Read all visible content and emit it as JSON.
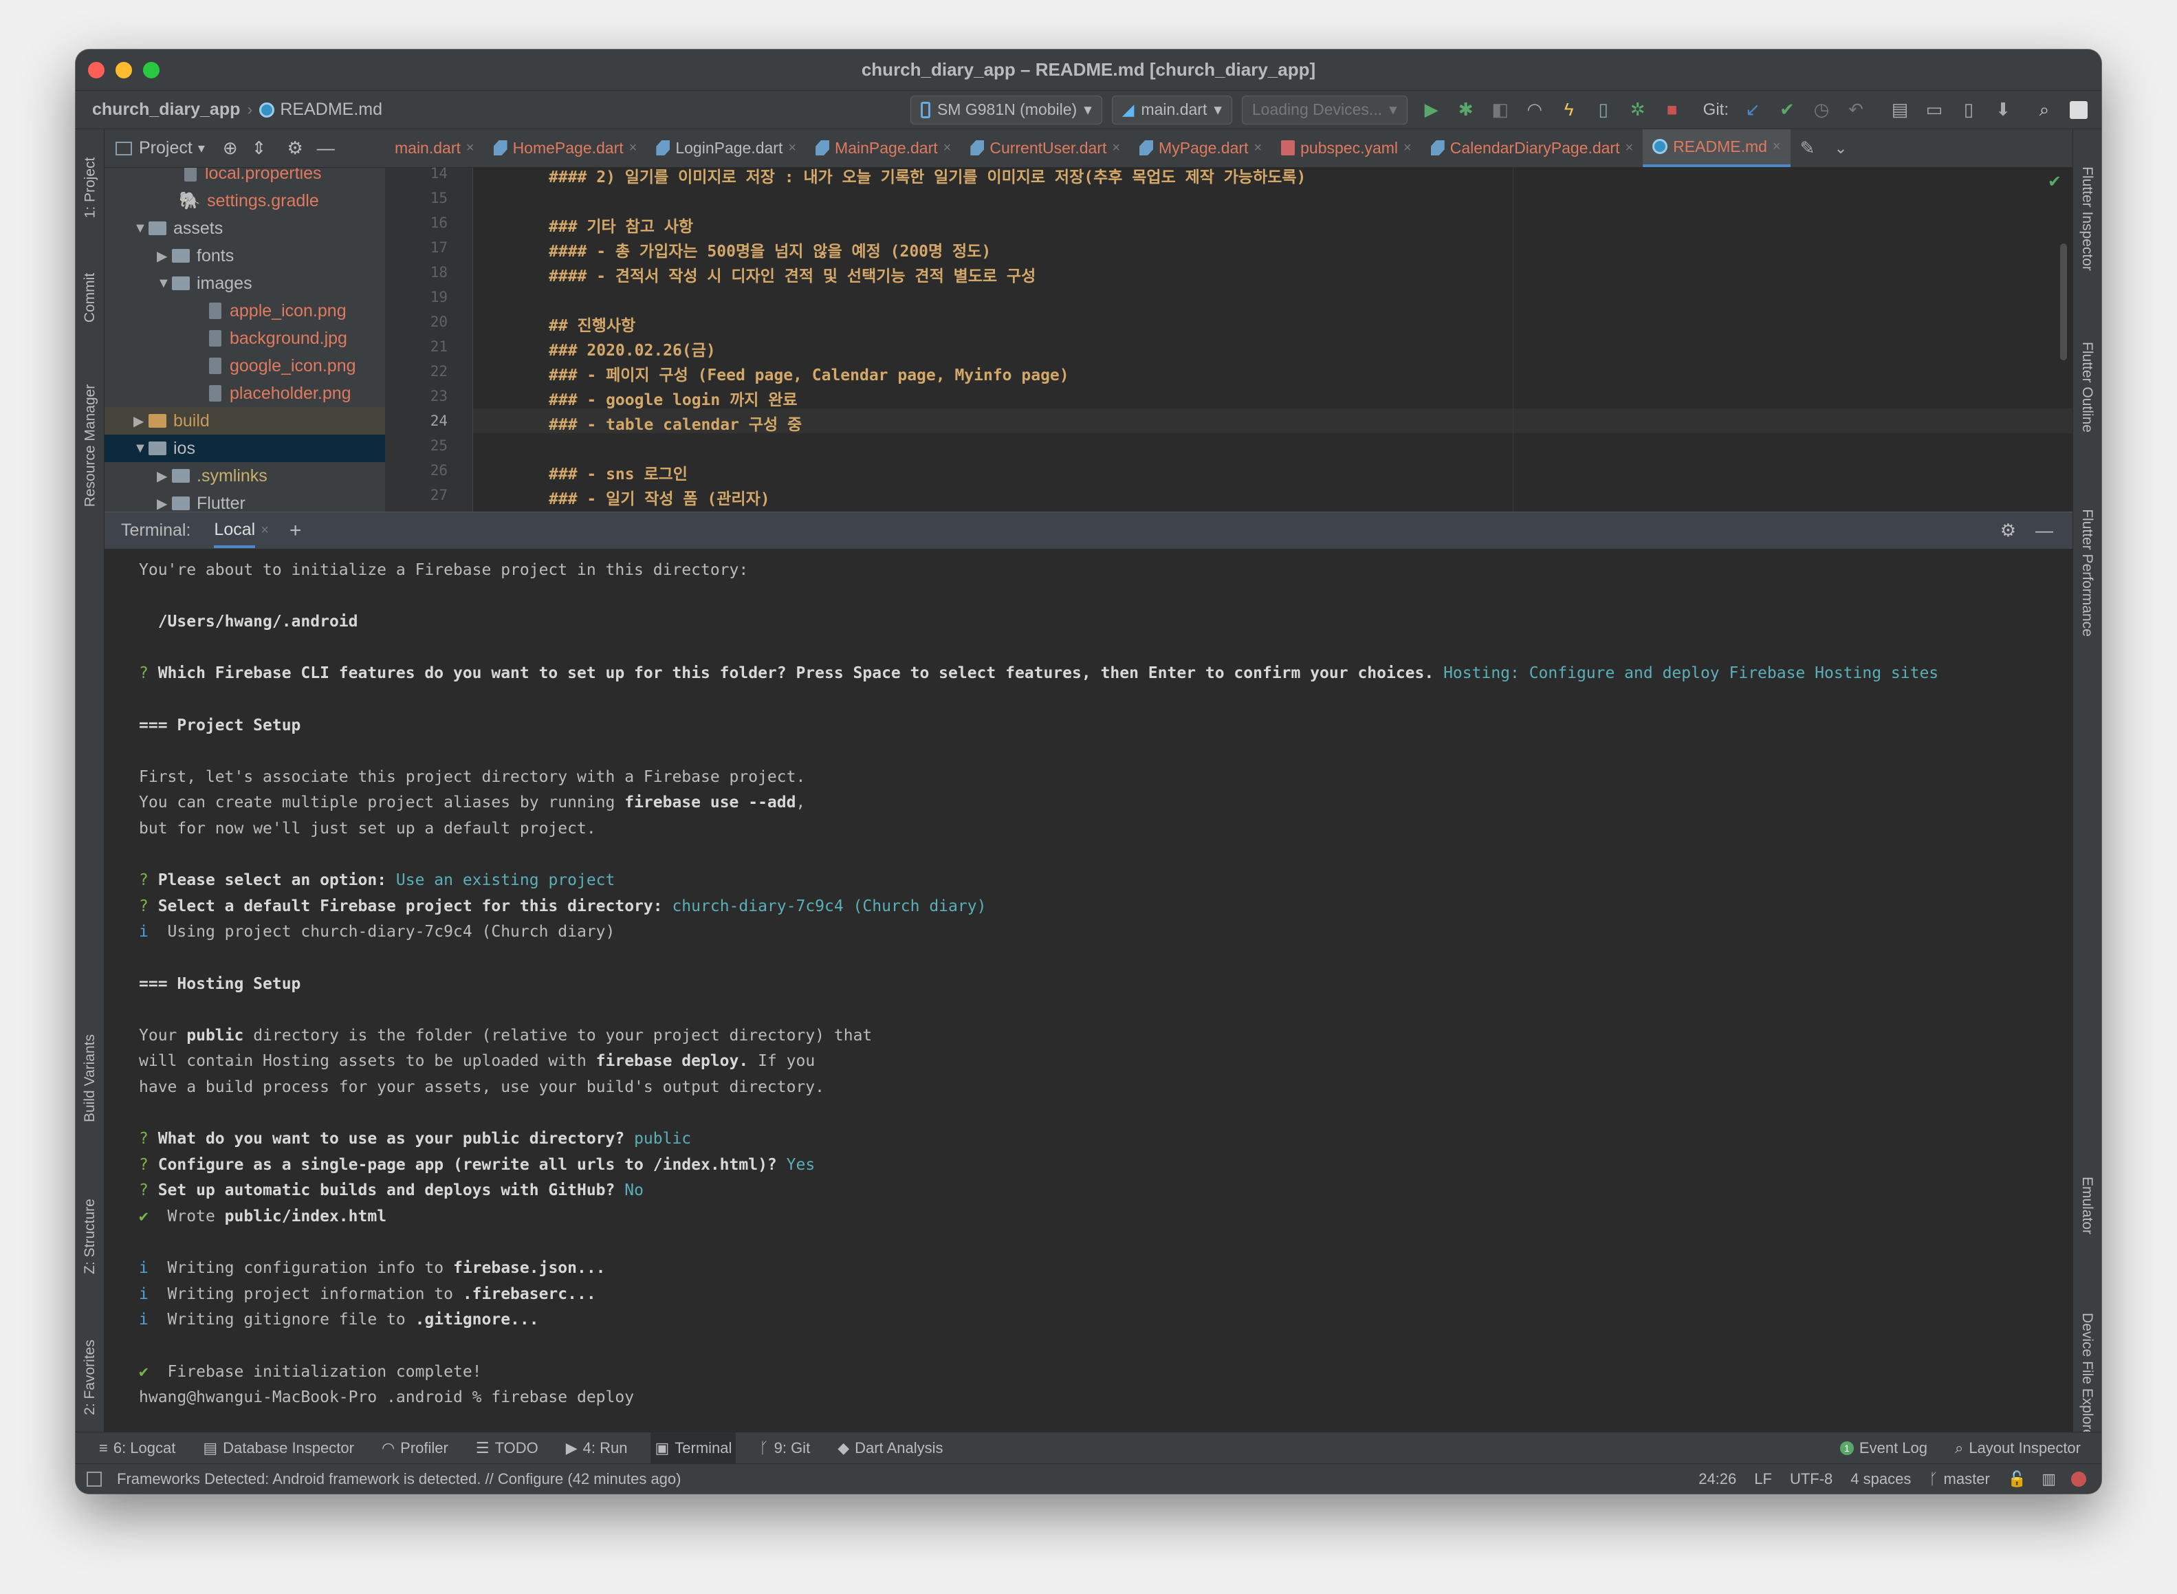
{
  "window": {
    "title": "church_diary_app – README.md [church_diary_app]"
  },
  "nav": {
    "project": "church_diary_app",
    "file": "README.md",
    "device": "SM G981N (mobile)",
    "run_config": "main.dart",
    "devices_loading": "Loading Devices...",
    "git_label": "Git:"
  },
  "project_panel": {
    "label": "Project"
  },
  "tabs": [
    {
      "label": "main.dart",
      "icon": "none"
    },
    {
      "label": "HomePage.dart",
      "icon": "dart-file-icon"
    },
    {
      "label": "LoginPage.dart",
      "icon": "dart-file-icon"
    },
    {
      "label": "MainPage.dart",
      "icon": "dart-file-icon"
    },
    {
      "label": "CurrentUser.dart",
      "icon": "dart-file-icon"
    },
    {
      "label": "MyPage.dart",
      "icon": "dart-file-icon"
    },
    {
      "label": "pubspec.yaml",
      "icon": "yaml-file-icon"
    },
    {
      "label": "CalendarDiaryPage.dart",
      "icon": "dart-file-icon"
    },
    {
      "label": "README.md",
      "icon": "markdown-file-icon",
      "active": true
    }
  ],
  "tree": [
    {
      "label": "local.properties",
      "kind": "file",
      "color": "#e07a5f"
    },
    {
      "label": "settings.gradle",
      "kind": "file",
      "color": "#e07a5f"
    },
    {
      "label": "assets",
      "kind": "folder",
      "expanded": true,
      "color": "#bbbbbb"
    },
    {
      "label": "fonts",
      "kind": "folder",
      "expanded": false,
      "color": "#bbbbbb"
    },
    {
      "label": "images",
      "kind": "folder",
      "expanded": true,
      "color": "#bbbbbb"
    },
    {
      "label": "apple_icon.png",
      "kind": "file",
      "color": "#e07a5f"
    },
    {
      "label": "background.jpg",
      "kind": "file",
      "color": "#e07a5f"
    },
    {
      "label": "google_icon.png",
      "kind": "file",
      "color": "#e07a5f"
    },
    {
      "label": "placeholder.png",
      "kind": "file",
      "color": "#e07a5f"
    },
    {
      "label": "build",
      "kind": "folder",
      "expanded": false,
      "color": "#c89a5a"
    },
    {
      "label": "ios",
      "kind": "folder",
      "expanded": true,
      "color": "#bbbbbb"
    },
    {
      "label": ".symlinks",
      "kind": "folder",
      "expanded": false,
      "color": "#c9b06a"
    },
    {
      "label": "Flutter",
      "kind": "folder",
      "expanded": false,
      "color": "#bbbbbb"
    }
  ],
  "editor": {
    "line_numbers": [
      "14",
      "15",
      "16",
      "17",
      "18",
      "19",
      "20",
      "21",
      "22",
      "23",
      "24",
      "25",
      "26",
      "27"
    ],
    "current_line": "24",
    "lines": [
      "#### 2) 일기를 이미지로 저장 : 내가 오늘 기록한 일기를 이미지로 저장(추후 목업도 제작 가능하도록)",
      "",
      "### 기타 참고 사항",
      "#### - 총 가입자는 500명을 넘지 않을 예정 (200명 정도)",
      "#### - 견적서 작성 시 디자인 견적 및 선택기능 견적 별도로 구성",
      "",
      "## 진행사항",
      "### 2020.02.26(금)",
      "### - 페이지 구성 (Feed page, Calendar page, Myinfo page)",
      "### - google login 까지 완료",
      "### - table calendar 구성 중",
      "",
      "### - sns 로그인",
      "### - 일기 작성 폼 (관리자)"
    ]
  },
  "terminal": {
    "label": "Terminal:",
    "tab": "Local",
    "lines": [
      [
        {
          "t": "You're about to initialize a Firebase project in this directory:"
        }
      ],
      [],
      [
        {
          "t": "  /Users/hwang/.android",
          "s": "b"
        }
      ],
      [],
      [
        {
          "t": "? ",
          "s": "g"
        },
        {
          "t": "Which Firebase CLI features do you want to set up for this folder? Press Space to select features, then Enter to confirm your choices.",
          "s": "b"
        },
        {
          "t": " Hosting: Configure and deploy Firebase Hosting sites",
          "s": "c"
        }
      ],
      [],
      [
        {
          "t": "=== ",
          "s": "b"
        },
        {
          "t": "Project Setup",
          "s": "b"
        }
      ],
      [],
      [
        {
          "t": "First, let's associate this project directory with a Firebase project."
        }
      ],
      [
        {
          "t": "You can create multiple project aliases by running "
        },
        {
          "t": "firebase use --add",
          "s": "b"
        },
        {
          "t": ","
        }
      ],
      [
        {
          "t": "but for now we'll just set up a default project."
        }
      ],
      [],
      [
        {
          "t": "? ",
          "s": "g"
        },
        {
          "t": "Please select an option:",
          "s": "b"
        },
        {
          "t": " Use an existing project",
          "s": "c"
        }
      ],
      [
        {
          "t": "? ",
          "s": "g"
        },
        {
          "t": "Select a default Firebase project for this directory:",
          "s": "b"
        },
        {
          "t": " church-diary-7c9c4 (Church diary)",
          "s": "c"
        }
      ],
      [
        {
          "t": "i ",
          "s": "bi"
        },
        {
          "t": " Using project church-diary-7c9c4 (Church diary)"
        }
      ],
      [],
      [
        {
          "t": "=== ",
          "s": "b"
        },
        {
          "t": "Hosting Setup",
          "s": "b"
        }
      ],
      [],
      [
        {
          "t": "Your "
        },
        {
          "t": "public",
          "s": "b"
        },
        {
          "t": " directory is the folder (relative to your project directory) that"
        }
      ],
      [
        {
          "t": "will contain Hosting assets to be uploaded with "
        },
        {
          "t": "firebase deploy.",
          "s": "b"
        },
        {
          "t": " If you"
        }
      ],
      [
        {
          "t": "have a build process for your assets, use your build's output directory."
        }
      ],
      [],
      [
        {
          "t": "? ",
          "s": "g"
        },
        {
          "t": "What do you want to use as your public directory?",
          "s": "b"
        },
        {
          "t": " public",
          "s": "c"
        }
      ],
      [
        {
          "t": "? ",
          "s": "g"
        },
        {
          "t": "Configure as a single-page app (rewrite all urls to /index.html)?",
          "s": "b"
        },
        {
          "t": " Yes",
          "s": "c"
        }
      ],
      [
        {
          "t": "? ",
          "s": "g"
        },
        {
          "t": "Set up automatic builds and deploys with GitHub?",
          "s": "b"
        },
        {
          "t": " No",
          "s": "c"
        }
      ],
      [
        {
          "t": "✔ ",
          "s": "g"
        },
        {
          "t": " Wrote "
        },
        {
          "t": "public/index.html",
          "s": "b"
        }
      ],
      [],
      [
        {
          "t": "i ",
          "s": "bi"
        },
        {
          "t": " Writing configuration info to "
        },
        {
          "t": "firebase.json...",
          "s": "b"
        }
      ],
      [
        {
          "t": "i ",
          "s": "bi"
        },
        {
          "t": " Writing project information to "
        },
        {
          "t": ".firebaserc...",
          "s": "b"
        }
      ],
      [
        {
          "t": "i ",
          "s": "bi"
        },
        {
          "t": " Writing gitignore file to "
        },
        {
          "t": ".gitignore...",
          "s": "b"
        }
      ],
      [],
      [
        {
          "t": "✔ ",
          "s": "g"
        },
        {
          "t": " Firebase initialization complete!"
        }
      ],
      [
        {
          "t": "hwang@hwangui-MacBook-Pro .android % firebase deploy"
        }
      ]
    ]
  },
  "left_tools": [
    "1: Project",
    "Commit",
    "Resource Manager",
    "Build Variants",
    "Z: Structure",
    "2: Favorites"
  ],
  "right_tools": [
    "Flutter Inspector",
    "Flutter Outline",
    "Flutter Performance",
    "Emulator",
    "Device File Explorer"
  ],
  "bottom_tools": [
    {
      "label": "6: Logcat"
    },
    {
      "label": "Database Inspector"
    },
    {
      "label": "Profiler"
    },
    {
      "label": "TODO"
    },
    {
      "label": "4: Run"
    },
    {
      "label": "Terminal",
      "active": true
    },
    {
      "label": "9: Git"
    },
    {
      "label": "Dart Analysis"
    }
  ],
  "bottom_right_tools": [
    {
      "label": "Event Log"
    },
    {
      "label": "Layout Inspector"
    }
  ],
  "status": {
    "message": "Frameworks Detected: Android framework is detected. // Configure (42 minutes ago)",
    "position": "24:26",
    "line_sep": "LF",
    "encoding": "UTF-8",
    "indent": "4 spaces",
    "branch": "master"
  },
  "colors": {
    "accent": "#4a88c7",
    "modified_file": "#e07a5f",
    "terminal_cyan": "#5ab0b8",
    "markdown_header": "#d4a868"
  }
}
